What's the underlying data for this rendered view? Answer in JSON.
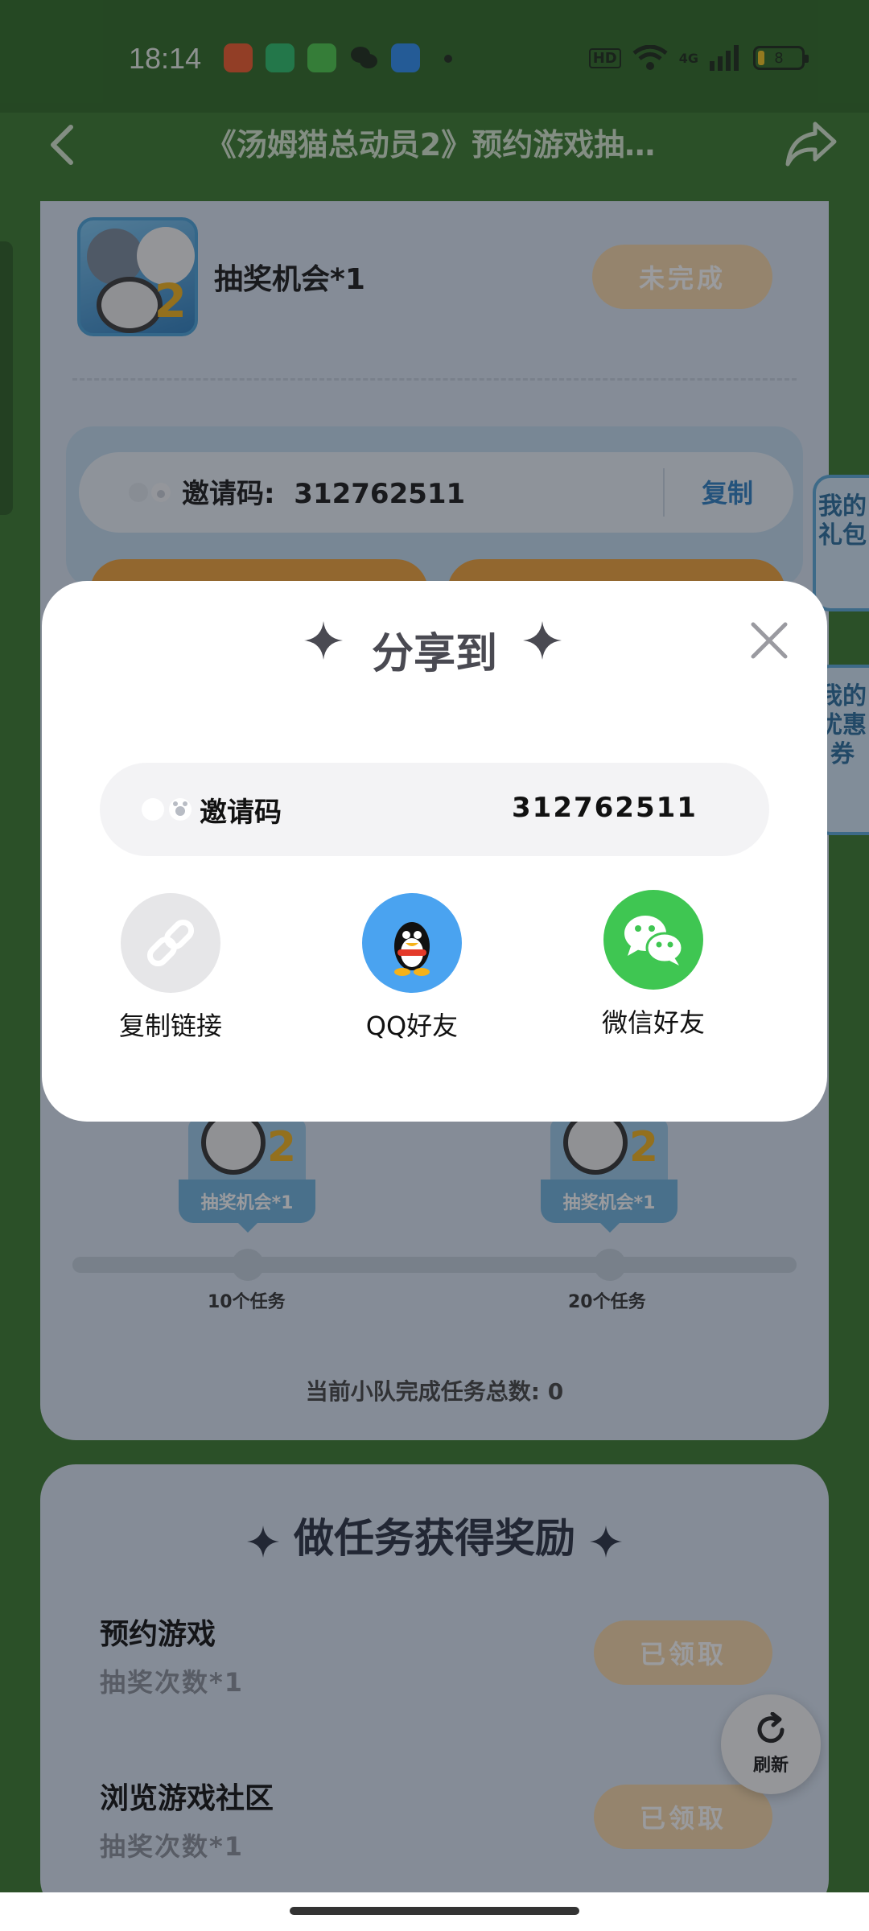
{
  "status_bar": {
    "time": "18:14",
    "hd": "HD",
    "network": "4G",
    "battery": "8"
  },
  "header": {
    "title": "《汤姆猫总动员2》预约游戏抽…"
  },
  "reward": {
    "label": "抽奖机会*1",
    "button": "未完成"
  },
  "invite": {
    "label": "邀请码:",
    "code": "312762511",
    "copy": "复制"
  },
  "side_tabs": {
    "gift": "我的礼包",
    "coupon": "我的优惠券"
  },
  "milestones": [
    {
      "tag": "抽奖机会*1",
      "label": "10个任务"
    },
    {
      "tag": "抽奖机会*1",
      "label": "20个任务"
    }
  ],
  "team_total": "当前小队完成任务总数: 0",
  "tasks": {
    "title": "做任务获得奖励",
    "items": [
      {
        "name": "预约游戏",
        "sub": "抽奖次数*1",
        "button": "已领取"
      },
      {
        "name": "浏览游戏社区",
        "sub": "抽奖次数*1",
        "button": "已领取"
      }
    ]
  },
  "refresh": "刷新",
  "modal": {
    "title": "分享到",
    "code_label": "邀请码",
    "code_value": "312762511",
    "options": [
      {
        "label": "复制链接",
        "color": "#e6e6e8"
      },
      {
        "label": "QQ好友",
        "color": "#4aa3f0"
      },
      {
        "label": "微信好友",
        "color": "#3fc652"
      }
    ]
  },
  "colors": {
    "brand_green": "#3a7a2e",
    "wechat_green": "#3fc652",
    "qq_blue": "#4aa3f0"
  }
}
